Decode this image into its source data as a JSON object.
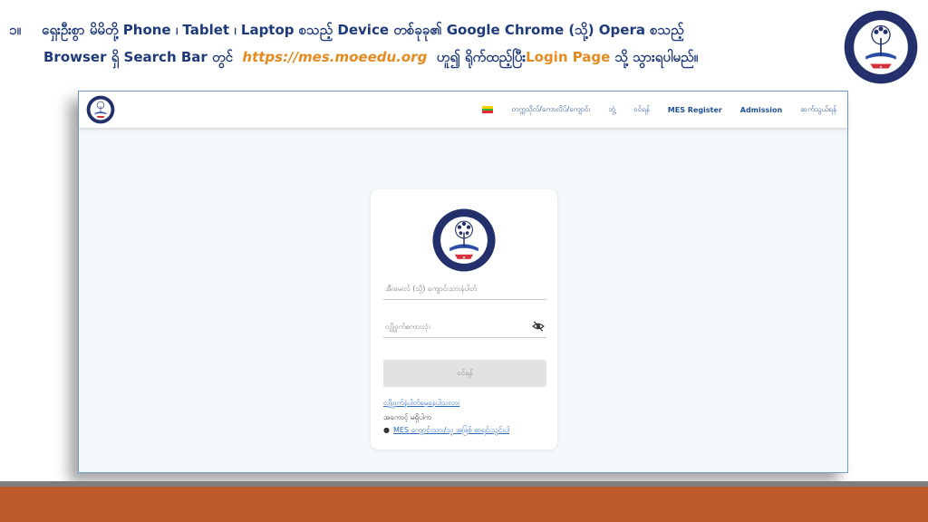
{
  "heading": {
    "number": "၁။",
    "line1": "ရှေးဦးစွာ မိမိတို့ Phone ၊ Tablet ၊ Laptop စသည့် Device တစ်ခုခု၏ Google Chrome (သို့) Opera စသည့်",
    "line2_pre": "Browser ရှိ Search Bar တွင်",
    "url": "https://mes.moeedu.org",
    "line2_mid": "ဟူ၍ ရိုက်ထည့်ပြီး",
    "login_page": "Login Page",
    "line2_post": "သို့ သွားရပါမည်။"
  },
  "navbar": {
    "links": [
      "တက္ကသိုလ်/ကောလိပ်/ကျောင်း",
      "ဘွဲ့",
      "ဝင်ရန်",
      "MES Register",
      "Admission",
      "ဆက်သွယ်ရန်"
    ]
  },
  "login": {
    "username_placeholder": "အီးမေးလ် (သို့) ကျောင်းသားနံပါတ်",
    "password_placeholder": "လျှို့ဝှက်စကားလုံး",
    "button_label": "ဝင်ရန်",
    "forgot_link": "လျှို့ဝှက်နံပါတ်မေ့နေပါသလား",
    "no_account": "အကောင့် မရှိပါက",
    "register_link": "MES ကျောင်းသား/သူ အဖြစ် စာရင်းသွင်းပါ"
  },
  "colors": {
    "heading": "#1f3a7a",
    "accent_orange": "#e58a1f",
    "logo_navy": "#23306b",
    "footer_orange": "#bd5a2a"
  },
  "icons": {
    "logo": "moeedu-emblem-icon",
    "flag": "myanmar-flag-icon",
    "password_toggle": "eye-slash-icon"
  }
}
